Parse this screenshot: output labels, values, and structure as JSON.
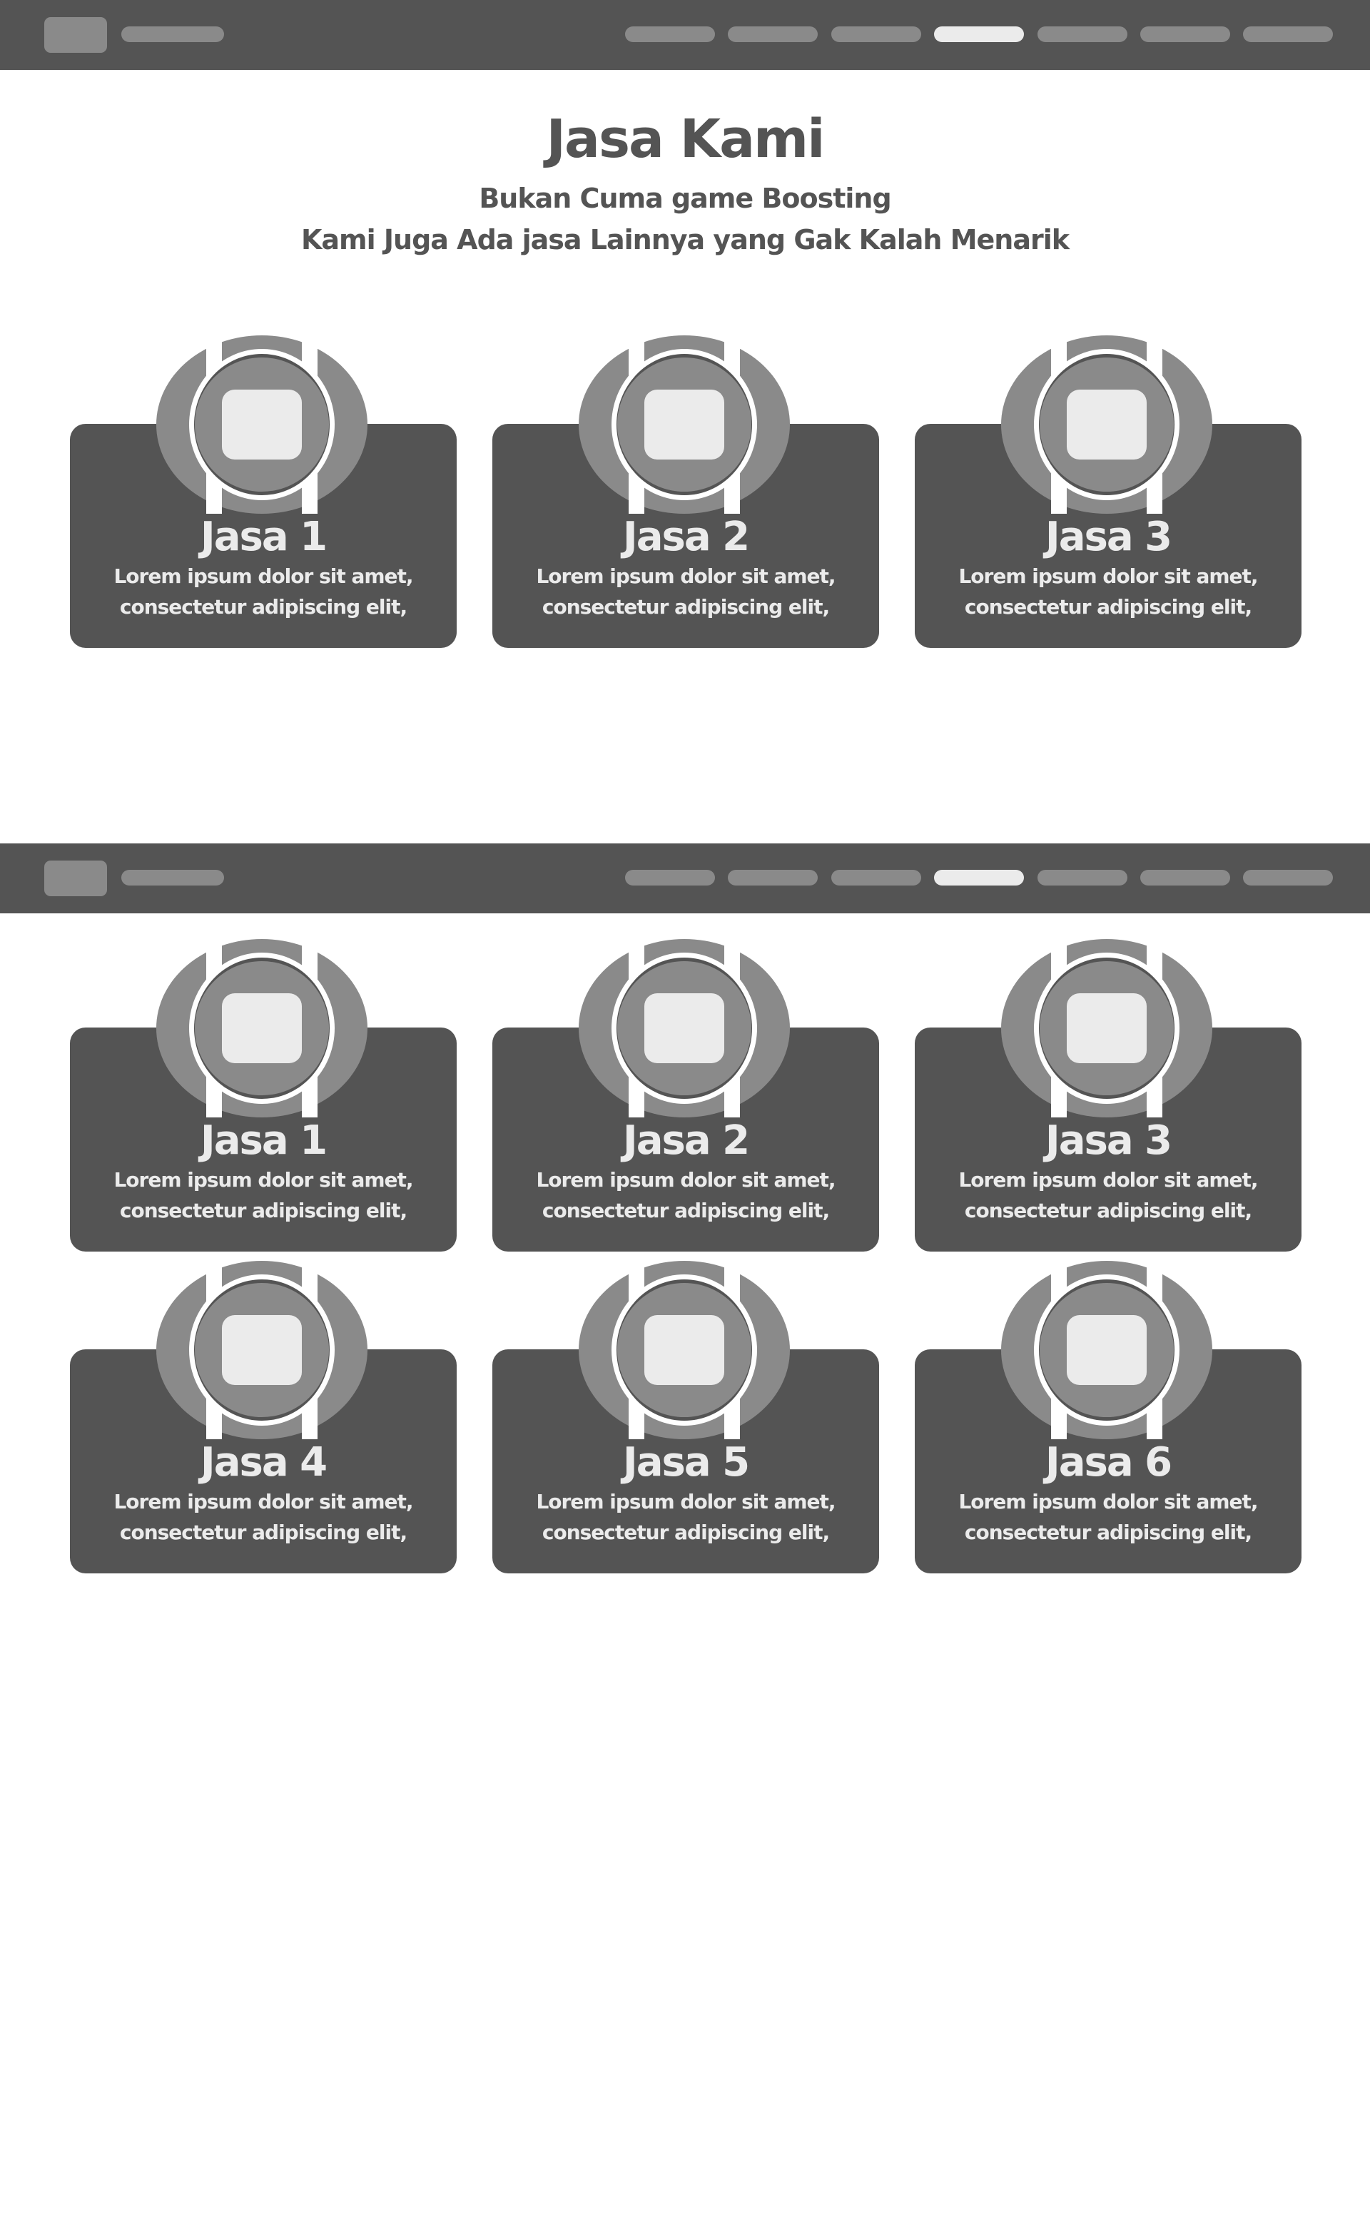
{
  "colors": {
    "dark": "#545454",
    "mid": "#8a8a8a",
    "light": "#ebebeb",
    "background": "#ffffff"
  },
  "navbar": {
    "link_count": 7,
    "active_index": 3
  },
  "section1": {
    "title": "Jasa Kami",
    "subtitle_line1": "Bukan Cuma game Boosting",
    "subtitle_line2": "Kami Juga Ada jasa Lainnya yang Gak Kalah Menarik",
    "cards": [
      {
        "title": "Jasa 1",
        "desc_line1": "Lorem ipsum dolor sit amet,",
        "desc_line2": "consectetur adipiscing elit,",
        "icon": "service-emblem-icon"
      },
      {
        "title": "Jasa 2",
        "desc_line1": "Lorem ipsum dolor sit amet,",
        "desc_line2": "consectetur adipiscing elit,",
        "icon": "service-emblem-icon"
      },
      {
        "title": "Jasa 3",
        "desc_line1": "Lorem ipsum dolor sit amet,",
        "desc_line2": "consectetur adipiscing elit,",
        "icon": "service-emblem-icon"
      }
    ]
  },
  "section2": {
    "cards": [
      {
        "title": "Jasa 1",
        "desc_line1": "Lorem ipsum dolor sit amet,",
        "desc_line2": "consectetur adipiscing elit,",
        "icon": "service-emblem-icon"
      },
      {
        "title": "Jasa 2",
        "desc_line1": "Lorem ipsum dolor sit amet,",
        "desc_line2": "consectetur adipiscing elit,",
        "icon": "service-emblem-icon"
      },
      {
        "title": "Jasa 3",
        "desc_line1": "Lorem ipsum dolor sit amet,",
        "desc_line2": "consectetur adipiscing elit,",
        "icon": "service-emblem-icon"
      },
      {
        "title": "Jasa 4",
        "desc_line1": "Lorem ipsum dolor sit amet,",
        "desc_line2": "consectetur adipiscing elit,",
        "icon": "service-emblem-icon"
      },
      {
        "title": "Jasa 5",
        "desc_line1": "Lorem ipsum dolor sit amet,",
        "desc_line2": "consectetur adipiscing elit,",
        "icon": "service-emblem-icon"
      },
      {
        "title": "Jasa 6",
        "desc_line1": "Lorem ipsum dolor sit amet,",
        "desc_line2": "consectetur adipiscing elit,",
        "icon": "service-emblem-icon"
      }
    ]
  }
}
